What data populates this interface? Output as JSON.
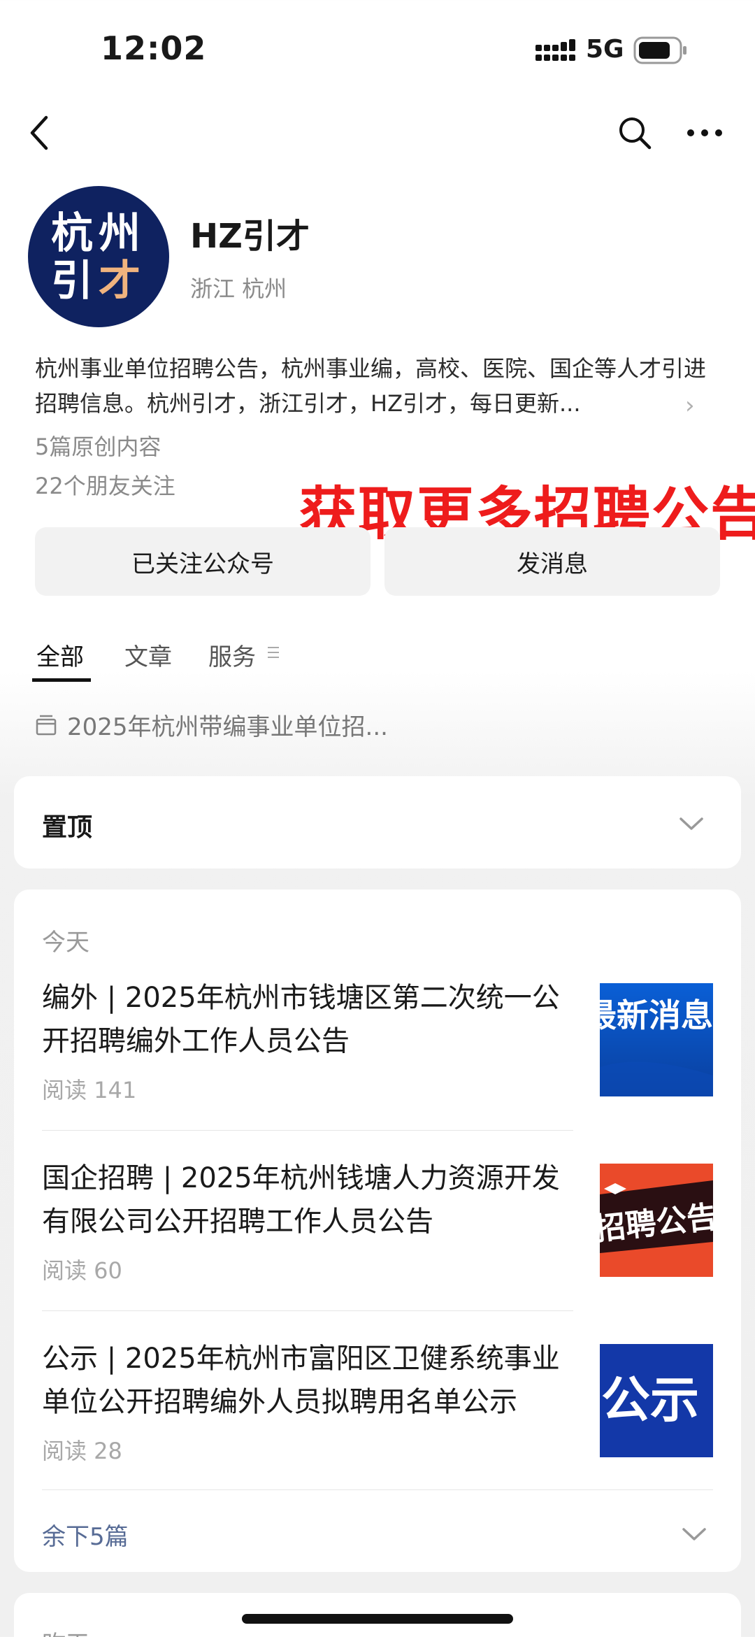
{
  "status_bar": {
    "time": "12:02",
    "network": "5G"
  },
  "account": {
    "avatar_line1": "杭州",
    "avatar_line2_a": "引",
    "avatar_line2_b": "才",
    "name": "HZ引才",
    "location": "浙江 杭州",
    "description": "杭州事业单位招聘公告，杭州事业编，高校、医院、国企等人才引进招聘信息。杭州引才，浙江引才，HZ引才，每日更新...",
    "original_count": "5篇原创内容",
    "friends_following": "22个朋友关注"
  },
  "promo_banner": "获取更多招聘公告",
  "buttons": {
    "followed": "已关注公众号",
    "message": "发消息"
  },
  "tabs": [
    {
      "label": "全部",
      "active": true
    },
    {
      "label": "文章",
      "active": false
    },
    {
      "label": "服务",
      "active": false
    }
  ],
  "pinned_collection": "2025年杭州带编事业单位招...",
  "pinned_section": {
    "label": "置顶"
  },
  "today_section": {
    "label": "今天",
    "articles": [
      {
        "title": "编外 | 2025年杭州市钱塘区第二次统一公开招聘编外工作人员公告",
        "reads": "阅读 141",
        "thumb_text": "最新消息"
      },
      {
        "title": "国企招聘 | 2025年杭州钱塘人力资源开发有限公司公开招聘工作人员公告",
        "reads": "阅读 60",
        "thumb_text": "招聘公告"
      },
      {
        "title": "公示 | 2025年杭州市富阳区卫健系统事业单位公开招聘编外人员拟聘用名单公示",
        "reads": "阅读 28",
        "thumb_text": "公示"
      }
    ],
    "more_label": "余下5篇"
  },
  "next_section": {
    "label": "昨天"
  },
  "colors": {
    "promo_red": "#ee1c1c",
    "link_blue": "#576b95",
    "avatar_navy": "#0f2260",
    "avatar_accent": "#f0b37e"
  },
  "icons": [
    "back-arrow-icon",
    "search-icon",
    "more-dots-icon",
    "signal-icon",
    "battery-icon",
    "chevron-right-icon",
    "menu-lines-icon",
    "folder-icon",
    "chevron-down-icon"
  ]
}
